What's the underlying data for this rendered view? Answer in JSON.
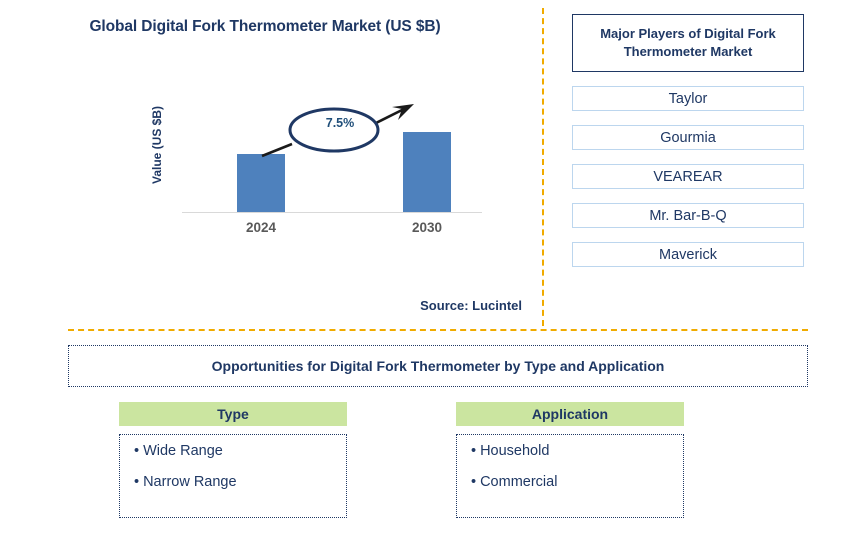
{
  "chart_panel": {
    "title": "Global Digital Fork Thermometer Market (US $B)",
    "source": "Source: Lucintel"
  },
  "chart_data": {
    "type": "bar",
    "title": "Global Digital Fork Thermometer Market (US $B)",
    "categories": [
      "2024",
      "2030"
    ],
    "values": [
      58,
      80
    ],
    "xlabel": "",
    "ylabel": "Value (US $B)",
    "grid": false,
    "legend": "none",
    "annotations": [
      {
        "label": "7.5%",
        "type": "cagr-callout",
        "from_category": "2024",
        "to_category": "2030"
      }
    ],
    "series": [
      {
        "name": "Value (US $B)",
        "values": [
          58,
          80
        ]
      }
    ],
    "bar_color": "#4e81bd"
  },
  "players": {
    "header": "Major Players of Digital Fork Thermometer Market",
    "items": [
      {
        "label": "Taylor"
      },
      {
        "label": "Gourmia"
      },
      {
        "label": "VEAREAR"
      },
      {
        "label": "Mr. Bar-B-Q"
      },
      {
        "label": "Maverick"
      }
    ]
  },
  "opportunities": {
    "title": "Opportunities for Digital Fork Thermometer by Type and Application",
    "columns": [
      {
        "header": "Type",
        "items": [
          {
            "bullet": "•",
            "label": "Wide Range"
          },
          {
            "bullet": "•",
            "label": "Narrow Range"
          }
        ]
      },
      {
        "header": "Application",
        "items": [
          {
            "bullet": "•",
            "label": "Household"
          },
          {
            "bullet": "•",
            "label": "Commercial"
          }
        ]
      }
    ]
  },
  "colors": {
    "navy": "#1f3864",
    "bar_blue": "#4e81bd",
    "divider_orange": "#f0ab00",
    "header_green": "#cbe5a0",
    "item_border_blue": "#bcd6ee",
    "year_gray": "#595959"
  }
}
